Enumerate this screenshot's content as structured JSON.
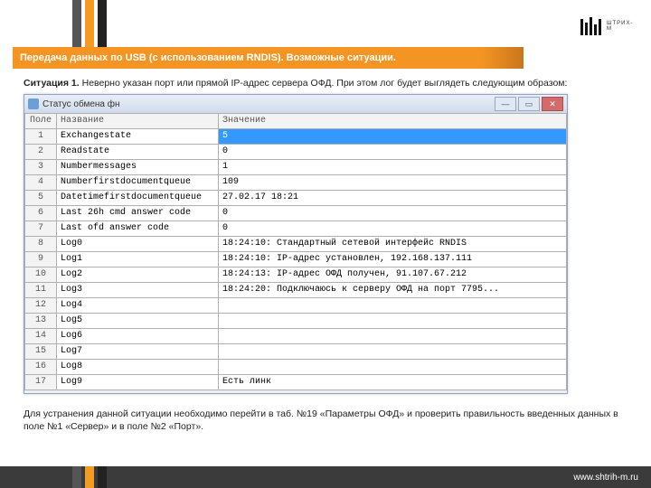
{
  "brand": "ШТРИХ-М",
  "title": "Передача данных по USB (с использованием RNDIS). Возможные ситуации.",
  "situation": {
    "label": "Ситуация 1. ",
    "text": "Неверно указан порт или прямой IP-адрес сервера ОФД. При этом лог будет выглядеть следующим образом:"
  },
  "window": {
    "title": "Статус обмена фн",
    "cols": [
      "Поле",
      "Название",
      "Значение"
    ],
    "rows": [
      {
        "n": "1",
        "name": "Exchangestate",
        "val": "5",
        "sel": true
      },
      {
        "n": "2",
        "name": "Readstate",
        "val": "0"
      },
      {
        "n": "3",
        "name": "Numbermessages",
        "val": "1"
      },
      {
        "n": "4",
        "name": "Numberfirstdocumentqueue",
        "val": "109"
      },
      {
        "n": "5",
        "name": "Datetimefirstdocumentqueue",
        "val": "27.02.17 18:21"
      },
      {
        "n": "6",
        "name": "Last 26h cmd answer code",
        "val": "0"
      },
      {
        "n": "7",
        "name": "Last ofd answer code",
        "val": "0"
      },
      {
        "n": "8",
        "name": "Log0",
        "val": "18:24:10: Стандартный сетевой интерфейс RNDIS"
      },
      {
        "n": "9",
        "name": "Log1",
        "val": "18:24:10: IP-адрес установлен, 192.168.137.111"
      },
      {
        "n": "10",
        "name": "Log2",
        "val": "18:24:13: IP-адрес ОФД получен, 91.107.67.212"
      },
      {
        "n": "11",
        "name": "Log3",
        "val": "18:24:20: Подключаюсь к серверу ОФД на порт 7795..."
      },
      {
        "n": "12",
        "name": "Log4",
        "val": ""
      },
      {
        "n": "13",
        "name": "Log5",
        "val": ""
      },
      {
        "n": "14",
        "name": "Log6",
        "val": ""
      },
      {
        "n": "15",
        "name": "Log7",
        "val": ""
      },
      {
        "n": "16",
        "name": "Log8",
        "val": ""
      },
      {
        "n": "17",
        "name": "Log9",
        "val": "Есть линк"
      }
    ]
  },
  "remedy": "Для устранения данной ситуации необходимо перейти в таб. №19 «Параметры ОФД» и проверить правильность введенных данных в поле №1 «Сервер» и в поле №2 «Порт».",
  "footer": "www.shtrih-m.ru"
}
